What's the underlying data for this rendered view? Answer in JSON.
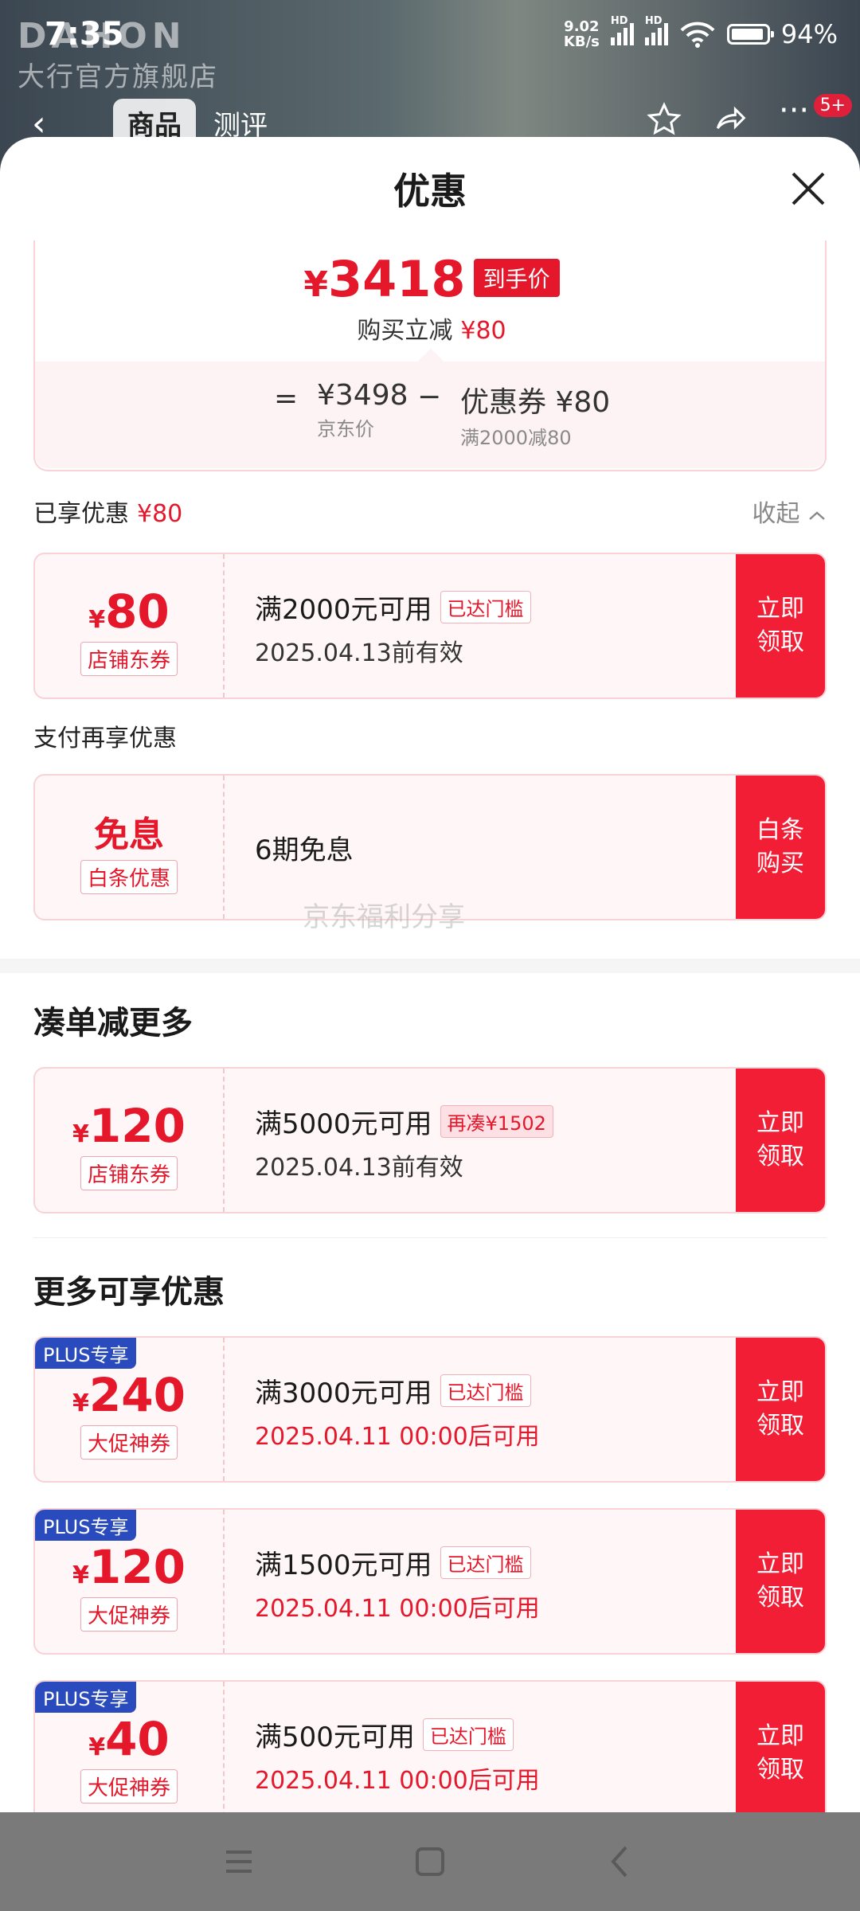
{
  "status": {
    "time": "7:35",
    "net_speed_top": "9.02",
    "net_speed_bottom": "KB/s",
    "signal_label": "HD",
    "battery": "94%"
  },
  "store": {
    "logo_text": "DAHON",
    "name": "大行官方旗舰店"
  },
  "nav": {
    "tab_goods": "商品",
    "tab_review": "测评",
    "badge": "5+"
  },
  "sheet": {
    "title": "优惠"
  },
  "price": {
    "currency": "¥",
    "final": "3418",
    "final_tag": "到手价",
    "reduce_label": "购买立减",
    "reduce_amount": "¥80",
    "eq": "=",
    "base_value": "¥3498",
    "base_label": "京东价",
    "minus": "−",
    "coupon_value": "优惠券 ¥80",
    "coupon_label": "满2000减80"
  },
  "enjoyed": {
    "label": "已享优惠",
    "amount": "¥80",
    "collapse": "收起"
  },
  "coupon_store": {
    "cur": "¥",
    "amount": "80",
    "type": "店铺东券",
    "cond": "满2000元可用",
    "pill": "已达门槛",
    "date": "2025.04.13前有效",
    "btn": "立即领取"
  },
  "pay": {
    "label": "支付再享优惠",
    "amount": "免息",
    "type": "白条优惠",
    "desc": "6期免息",
    "btn": "白条购买"
  },
  "watermark": "京东福利分享",
  "more_section": {
    "title": "凑单减更多",
    "coupon": {
      "cur": "¥",
      "amount": "120",
      "type": "店铺东券",
      "cond": "满5000元可用",
      "pill": "再凑¥1502",
      "date": "2025.04.13前有效",
      "btn": "立即领取"
    }
  },
  "extra_section": {
    "title": "更多可享优惠",
    "coupons": [
      {
        "tag": "PLUS专享",
        "cur": "¥",
        "amount": "240",
        "type": "大促神券",
        "cond": "满3000元可用",
        "pill": "已达门槛",
        "date": "2025.04.11 00:00后可用",
        "btn": "立即领取"
      },
      {
        "tag": "PLUS专享",
        "cur": "¥",
        "amount": "120",
        "type": "大促神券",
        "cond": "满1500元可用",
        "pill": "已达门槛",
        "date": "2025.04.11 00:00后可用",
        "btn": "立即领取"
      },
      {
        "tag": "PLUS专享",
        "cur": "¥",
        "amount": "40",
        "type": "大促神券",
        "cond": "满500元可用",
        "pill": "已达门槛",
        "date": "2025.04.11 00:00后可用",
        "btn": "立即领取"
      }
    ]
  }
}
